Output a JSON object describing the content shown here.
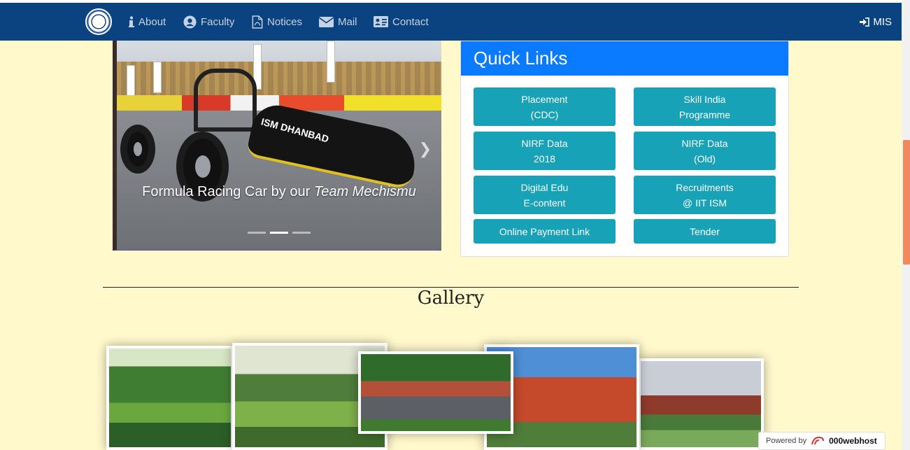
{
  "nav": {
    "items": [
      {
        "label": "About",
        "icon": "info-icon"
      },
      {
        "label": "Faculty",
        "icon": "user-circle-icon"
      },
      {
        "label": "Notices",
        "icon": "pdf-file-icon"
      },
      {
        "label": "Mail",
        "icon": "envelope-icon"
      },
      {
        "label": "Contact",
        "icon": "address-card-icon"
      }
    ],
    "mis_label": "MIS"
  },
  "carousel": {
    "caption_plain": "Formula Racing Car by our ",
    "caption_em": "Team Mechismu",
    "car_text": "ISM DHANBAD",
    "slides": 3,
    "active_slide": 2
  },
  "quick_links": {
    "title": "Quick Links",
    "buttons": [
      {
        "line1": "Placement",
        "line2": "(CDC)"
      },
      {
        "line1": "Skill India",
        "line2": "Programme"
      },
      {
        "line1": "NIRF Data",
        "line2": "2018"
      },
      {
        "line1": "NIRF Data",
        "line2": "(Old)"
      },
      {
        "line1": "Digital Edu",
        "line2": "E-content"
      },
      {
        "line1": "Recruitments",
        "line2": "@ IIT ISM"
      },
      {
        "line1": "Online Payment Link",
        "line2": ""
      },
      {
        "line1": "Tender",
        "line2": ""
      }
    ],
    "button_color": "#17a2b8",
    "header_color": "#0a7bff"
  },
  "gallery": {
    "title": "Gallery"
  },
  "badge": {
    "prefix": "Powered by",
    "brand": "000webhost"
  },
  "colors": {
    "navbar": "#0b4280",
    "background": "#fff9cc"
  }
}
